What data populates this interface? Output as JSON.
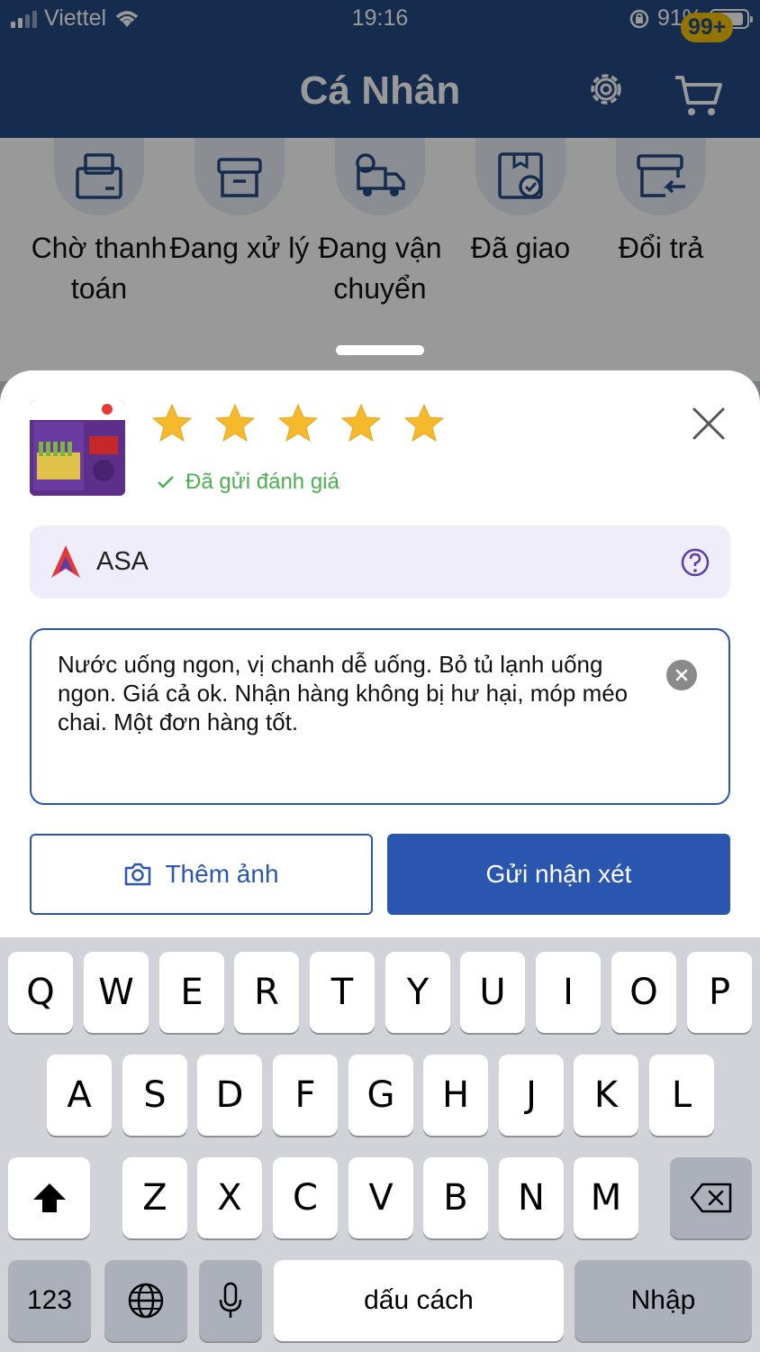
{
  "status_bar": {
    "carrier": "Viettel",
    "time": "19:16",
    "battery_percent": "91%"
  },
  "header": {
    "title": "Cá Nhân",
    "cart_badge": "99+"
  },
  "order_status": [
    {
      "label": "Chờ thanh toán",
      "icon": "wallet-icon"
    },
    {
      "label": "Đang xử lý",
      "icon": "box-icon"
    },
    {
      "label": "Đang vận chuyển",
      "icon": "truck-icon"
    },
    {
      "label": "Đã giao",
      "icon": "delivered-box-icon"
    },
    {
      "label": "Đổi trả",
      "icon": "return-box-icon"
    }
  ],
  "review": {
    "rating": 5,
    "max_rating": 5,
    "sent_status": "Đã gửi đánh giá",
    "brand": "ASA",
    "comment": "Nước uống ngon, vị chanh dễ uống. Bỏ tủ lạnh uống ngon. Giá cả ok. Nhận hàng không bị hư hại, móp méo chai. Một đơn hàng tốt.",
    "add_photo_label": "Thêm ảnh",
    "submit_label": "Gửi nhận xét"
  },
  "keyboard": {
    "row1": [
      "Q",
      "W",
      "E",
      "R",
      "T",
      "Y",
      "U",
      "I",
      "O",
      "P"
    ],
    "row2": [
      "A",
      "S",
      "D",
      "F",
      "G",
      "H",
      "J",
      "K",
      "L"
    ],
    "row3": [
      "Z",
      "X",
      "C",
      "V",
      "B",
      "N",
      "M"
    ],
    "numbers_label": "123",
    "space_label": "dấu cách",
    "return_label": "Nhập"
  },
  "colors": {
    "primary": "#264a83",
    "accent": "#2a56b0",
    "success": "#4caf50",
    "star": "#f6b92b"
  }
}
